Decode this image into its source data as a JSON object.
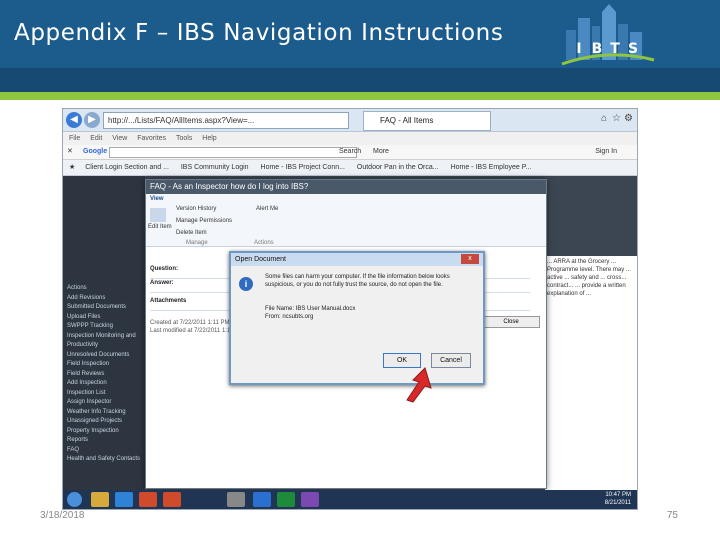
{
  "slide": {
    "title": "Appendix F – IBS Navigation Instructions",
    "date": "3/18/2018",
    "page_number": "75"
  },
  "logo": {
    "letters": [
      "I",
      "B",
      "T",
      "S"
    ]
  },
  "browser": {
    "address": "http://.../Lists/FAQ/AllItems.aspx?View=...",
    "tab_title": "FAQ - All Items",
    "menu": [
      "File",
      "Edit",
      "View",
      "Favorites",
      "Tools",
      "Help"
    ],
    "google_label": "Google",
    "search_label": "Search",
    "more_label": "More",
    "sign_in_label": "Sign In",
    "favorites": [
      "Client Login Section and ...",
      "IBS Community Login",
      "Home - IBS Project Conn...",
      "Outdoor Pan in the Orca...",
      "Home - IBS Employee P..."
    ]
  },
  "sharepoint": {
    "nav_items": [
      "Actions",
      "Add Revisions",
      "Submitted Documents",
      "Upload Files",
      "SWPPP Tracking",
      "Inspection Monitoring and",
      "Productivity",
      "Unresolved Documents",
      "Field Inspection",
      "Field Reviews",
      "Add Inspection",
      "Inspection List",
      "Assign Inspector",
      "Weather Info Tracking",
      "Unassigned Projects",
      "Property Inspection",
      "Reports",
      "FAQ",
      "Health and Safety Contacts"
    ],
    "right_text": "... ARRA at the Grocery ... Programme level. There may ... active ... safety and ... cross... contract... ... provide a written explanation of ..."
  },
  "faq_dialog": {
    "title": "FAQ - As an Inspector how do I log into IBS?",
    "ribbon": {
      "view_tab": "View",
      "version_history": "Version History",
      "manage_permissions": "Manage Permissions",
      "delete_item": "Delete Item",
      "edit_item": "Edit Item",
      "alert_me": "Alert Me",
      "manage_group": "Manage",
      "actions_group": "Actions"
    },
    "rows": [
      "Question:",
      "Answer:",
      "Attachments"
    ],
    "created": "Created at 7/22/2011 1:11 PM",
    "modified": "Last modified at 7/22/2011 1:11 PM",
    "close_label": "Close"
  },
  "open_document": {
    "title": "Open Document",
    "close_label": "x",
    "message": "Some files can harm your computer. If the file information below looks suspicious, or you do not fully trust the source, do not open the file.",
    "file_name": "File Name: IBS User Manual.docx",
    "from": "From: ncsubts.org",
    "ok_label": "OK",
    "cancel_label": "Cancel"
  },
  "taskbar": {
    "time": "10:47 PM",
    "date": "8/21/2011"
  },
  "colors": {
    "header_blue": "#1b5c8d",
    "stripe_green": "#8ec63f",
    "arrow_red": "#d8282a"
  }
}
